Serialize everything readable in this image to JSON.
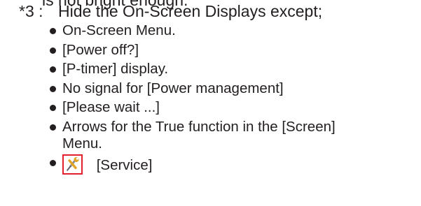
{
  "top_fragment": "is not bright enough.",
  "note": {
    "marker": "*3 :",
    "text": "Hide the On-Screen Displays except;"
  },
  "bullets": [
    {
      "text": "On-Screen Menu."
    },
    {
      "text": "[Power off?]"
    },
    {
      "text": "[P-timer] display."
    },
    {
      "text": "No signal for [Power management]"
    },
    {
      "text": "[Please wait ...]"
    },
    {
      "text": "Arrows for the True function in the [Screen]",
      "continuation": "Menu."
    },
    {
      "text": "[Service]",
      "icon": "service-tools-icon"
    }
  ],
  "colors": {
    "text": "#231f20",
    "icon_border": "#e3202e",
    "icon_wrench": "#e0a526",
    "icon_screwdriver": "#8a8f96"
  }
}
